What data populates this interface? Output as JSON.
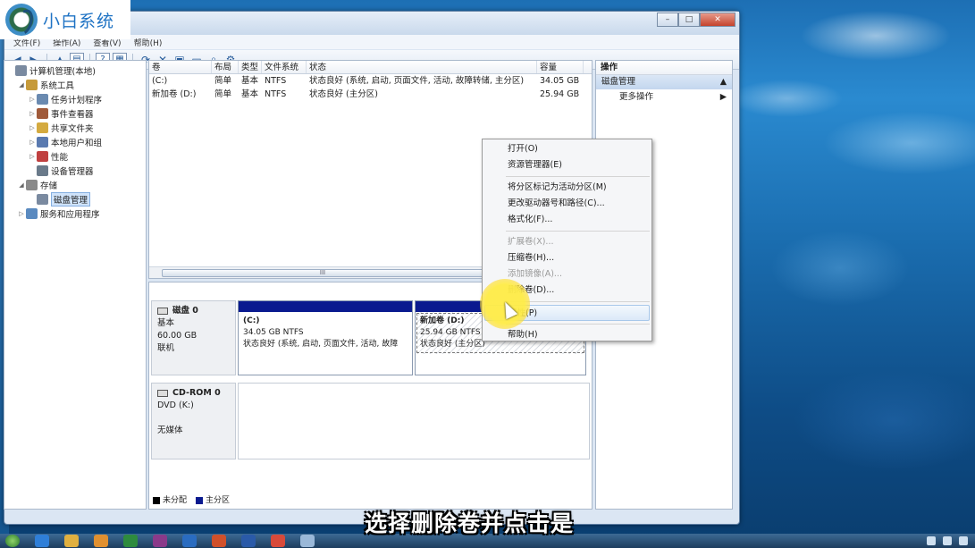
{
  "brand": {
    "name": "小白系统"
  },
  "window": {
    "controls": [
      "–",
      "□",
      "✕"
    ],
    "menus": [
      "文件(F)",
      "操作(A)",
      "查看(V)",
      "帮助(H)"
    ]
  },
  "tree": {
    "items": [
      {
        "label": "计算机管理(本地)",
        "level": 0,
        "arrow": "",
        "color": "#7a8aa0"
      },
      {
        "label": "系统工具",
        "level": 1,
        "arrow": "◢",
        "color": "#c69a3a"
      },
      {
        "label": "任务计划程序",
        "level": 2,
        "arrow": "▷",
        "color": "#6a8ab0"
      },
      {
        "label": "事件查看器",
        "level": 2,
        "arrow": "▷",
        "color": "#a05a3a"
      },
      {
        "label": "共享文件夹",
        "level": 2,
        "arrow": "▷",
        "color": "#d4aa40"
      },
      {
        "label": "本地用户和组",
        "level": 2,
        "arrow": "▷",
        "color": "#5a7ab0"
      },
      {
        "label": "性能",
        "level": 2,
        "arrow": "▷",
        "color": "#c04040"
      },
      {
        "label": "设备管理器",
        "level": 2,
        "arrow": "",
        "color": "#6a7a8a"
      },
      {
        "label": "存储",
        "level": 1,
        "arrow": "◢",
        "color": "#8a8a8a"
      },
      {
        "label": "磁盘管理",
        "level": 2,
        "arrow": "",
        "color": "#7a8aa0",
        "selected": true
      },
      {
        "label": "服务和应用程序",
        "level": 1,
        "arrow": "▷",
        "color": "#5a8ac0"
      }
    ]
  },
  "volumes": {
    "headers": [
      "卷",
      "布局",
      "类型",
      "文件系统",
      "状态",
      "容量"
    ],
    "rows": [
      [
        "(C:)",
        "简单",
        "基本",
        "NTFS",
        "状态良好 (系统, 启动, 页面文件, 活动, 故障转储, 主分区)",
        "34.05 GB"
      ],
      [
        "新加卷 (D:)",
        "简单",
        "基本",
        "NTFS",
        "状态良好 (主分区)",
        "25.94 GB"
      ]
    ],
    "scroll_grip": "III"
  },
  "disks": {
    "disk0": {
      "name": "磁盘 0",
      "type": "基本",
      "size": "60.00 GB",
      "status": "联机",
      "partitions": [
        {
          "title": "(C:)",
          "size": "34.05 GB NTFS",
          "status": "状态良好 (系统, 启动, 页面文件, 活动, 故障"
        },
        {
          "title": "新加卷  (D:)",
          "size": "25.94 GB NTFS",
          "status": "状态良好 (主分区)"
        }
      ]
    },
    "cdrom": {
      "name": "CD-ROM 0",
      "type": "DVD (K:)",
      "status": "无媒体"
    },
    "legend": [
      "未分配",
      "主分区"
    ]
  },
  "actions": {
    "title": "操作",
    "section": "磁盘管理",
    "item": "更多操作"
  },
  "context_menu": {
    "items": [
      {
        "label": "打开(O)",
        "state": "normal"
      },
      {
        "label": "资源管理器(E)",
        "state": "normal"
      },
      {
        "label": "-"
      },
      {
        "label": "将分区标记为活动分区(M)",
        "state": "normal"
      },
      {
        "label": "更改驱动器号和路径(C)...",
        "state": "normal"
      },
      {
        "label": "格式化(F)...",
        "state": "normal"
      },
      {
        "label": "-"
      },
      {
        "label": "扩展卷(X)...",
        "state": "disabled"
      },
      {
        "label": "压缩卷(H)...",
        "state": "normal"
      },
      {
        "label": "添加镜像(A)...",
        "state": "disabled"
      },
      {
        "label": "删除卷(D)...",
        "state": "normal"
      },
      {
        "label": "-"
      },
      {
        "label": "属性(P)",
        "state": "hover"
      },
      {
        "label": "-"
      },
      {
        "label": "帮助(H)",
        "state": "normal"
      }
    ]
  },
  "subtitle": "选择删除卷并点击是",
  "colors": {
    "primary_partition": "#0a1a8f",
    "unallocated": "#000000"
  }
}
